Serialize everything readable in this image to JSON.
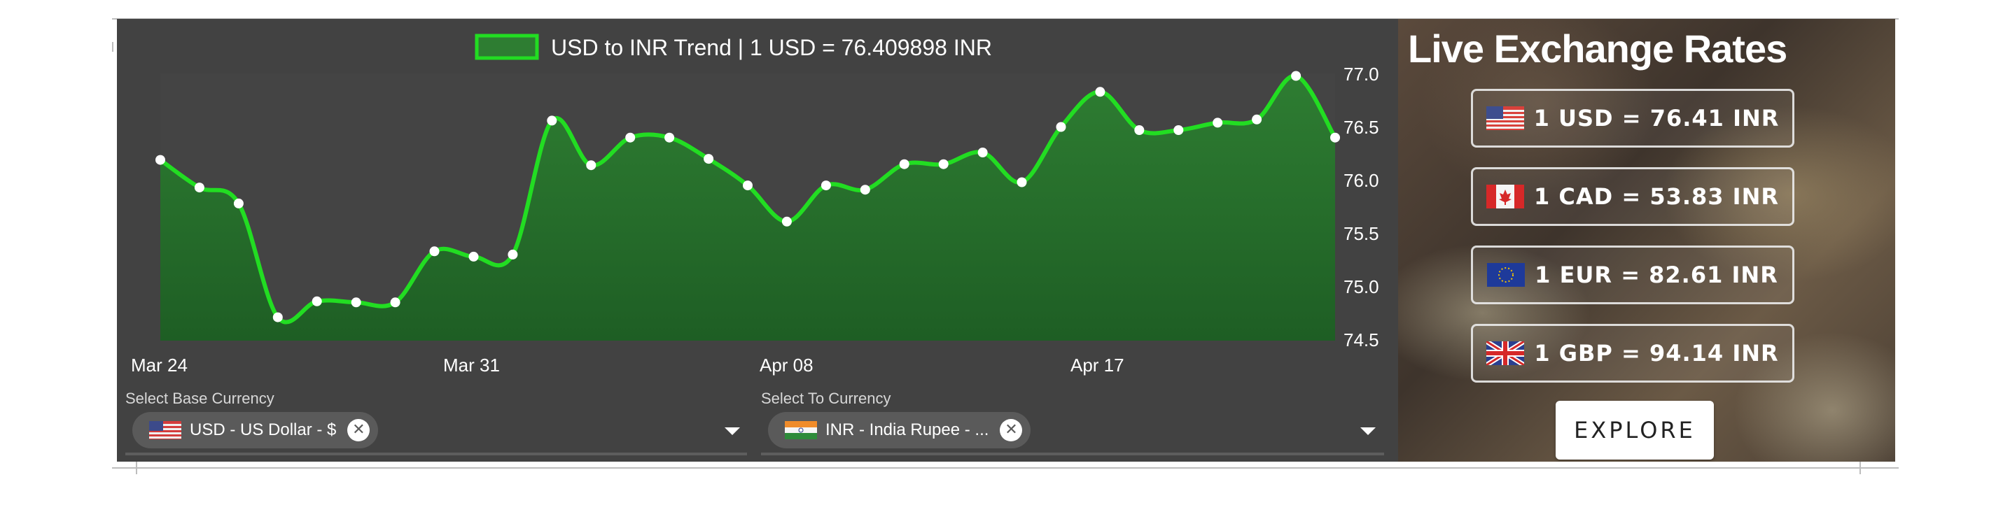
{
  "chart": {
    "legend_label": "USD to INR Trend | 1 USD = 76.409898 INR",
    "x_tick_labels": [
      "Mar 24",
      "Mar 31",
      "Apr 08",
      "Apr 17"
    ],
    "y_tick_labels": [
      "77.0",
      "76.5",
      "76.0",
      "75.5",
      "75.0",
      "74.5"
    ],
    "line_color": "#22dd22",
    "fill_color": "#2e7d32"
  },
  "chart_data": {
    "type": "area",
    "title": "USD to INR Trend | 1 USD = 76.409898 INR",
    "xlabel": "",
    "ylabel": "",
    "ylim": [
      74.5,
      77.0
    ],
    "x_ticks": [
      "Mar 24",
      "Mar 31",
      "Apr 08",
      "Apr 17"
    ],
    "grid": false,
    "legend": "top-center",
    "series": [
      {
        "name": "USD to INR Trend | 1 USD = 76.409898 INR",
        "values": [
          76.2,
          75.94,
          75.79,
          74.72,
          74.87,
          74.86,
          74.86,
          75.34,
          75.29,
          75.31,
          76.57,
          76.15,
          76.41,
          76.41,
          76.21,
          75.96,
          75.62,
          75.96,
          75.92,
          76.16,
          76.16,
          76.27,
          75.99,
          76.51,
          76.84,
          76.48,
          76.48,
          76.55,
          76.58,
          76.99,
          76.41
        ]
      }
    ]
  },
  "selectors": {
    "base": {
      "label": "Select Base Currency",
      "value": "USD - US Dollar - $"
    },
    "to": {
      "label": "Select To Currency",
      "value": "INR - India Rupee - ..."
    }
  },
  "rates": {
    "title": "Live Exchange Rates",
    "items": [
      {
        "flag": "us-flag-icon",
        "text": "1 USD = 76.41 INR"
      },
      {
        "flag": "canada-flag-icon",
        "text": "1 CAD = 53.83 INR"
      },
      {
        "flag": "eu-flag-icon",
        "text": "1 EUR = 82.61 INR"
      },
      {
        "flag": "uk-flag-icon",
        "text": "1 GBP = 94.14 INR"
      }
    ],
    "explore_label": "EXPLORE"
  }
}
